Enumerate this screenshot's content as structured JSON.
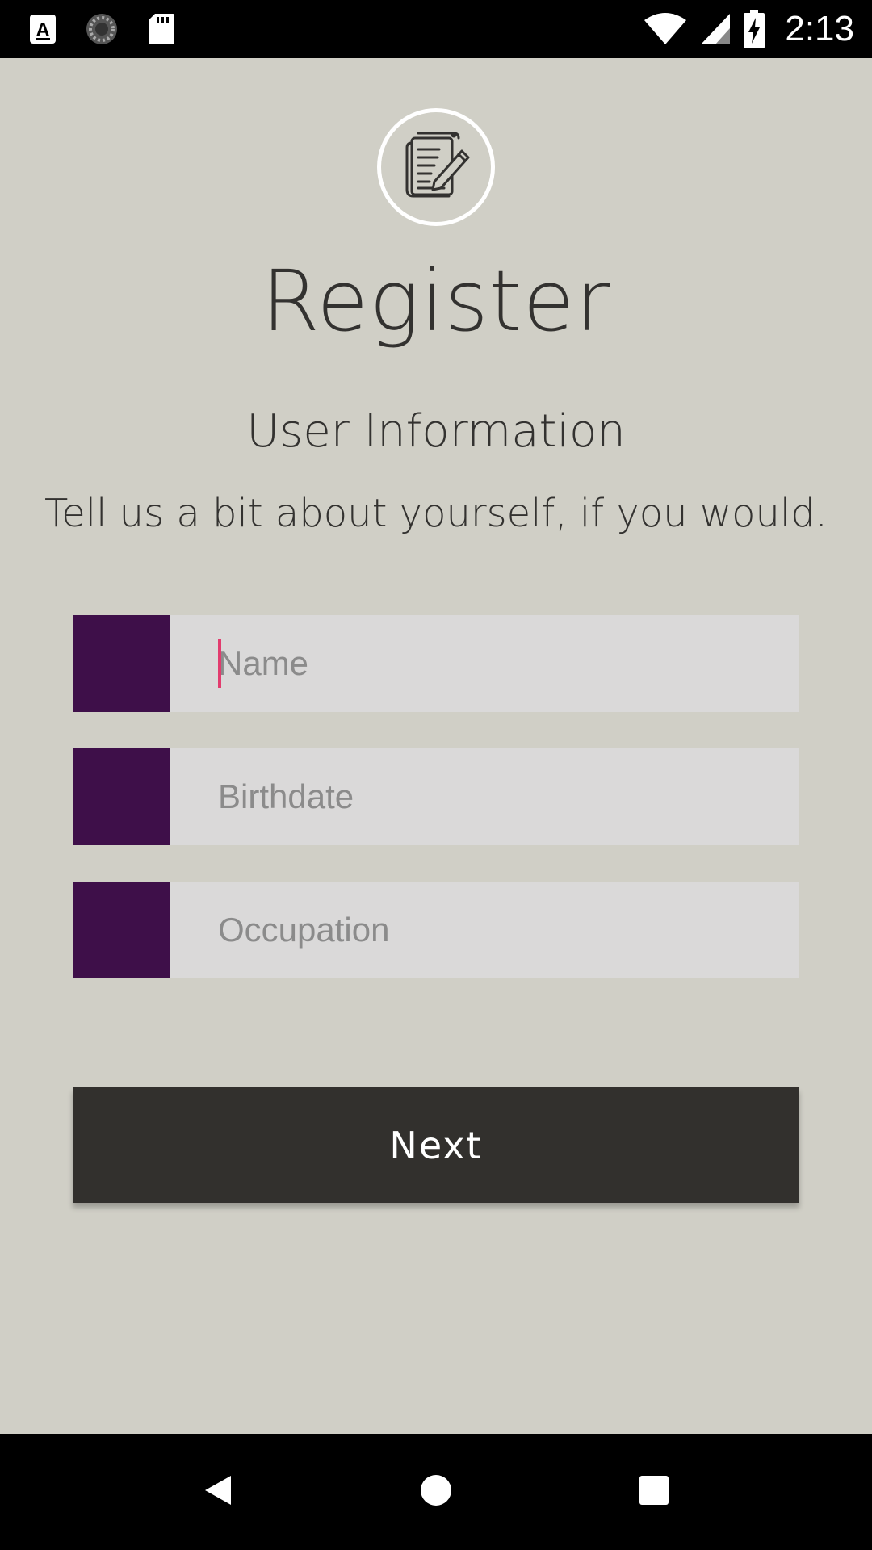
{
  "status_bar": {
    "time": "2:13",
    "left_icons": [
      "a-keyboard-icon",
      "loading-spinner-icon",
      "sd-card-icon"
    ],
    "right_icons": [
      "wifi-icon",
      "cell-signal-icon",
      "battery-charging-icon"
    ]
  },
  "header": {
    "logo_icon": "notepad-pencil-icon",
    "title": "Register",
    "subtitle": "User Information",
    "description": "Tell us a bit about yourself, if you would."
  },
  "form": {
    "fields": [
      {
        "placeholder": "Name",
        "value": ""
      },
      {
        "placeholder": "Birthdate",
        "value": ""
      },
      {
        "placeholder": "Occupation",
        "value": ""
      }
    ],
    "next_label": "Next"
  },
  "colors": {
    "background": "#d0cfc6",
    "field_swatch": "#3e0f49",
    "field_background": "#dad9d9",
    "button_background": "#32302d",
    "caret": "#e23c6e",
    "text": "#333230"
  },
  "nav_bar": {
    "buttons": [
      "back-icon",
      "home-icon",
      "recents-icon"
    ]
  }
}
